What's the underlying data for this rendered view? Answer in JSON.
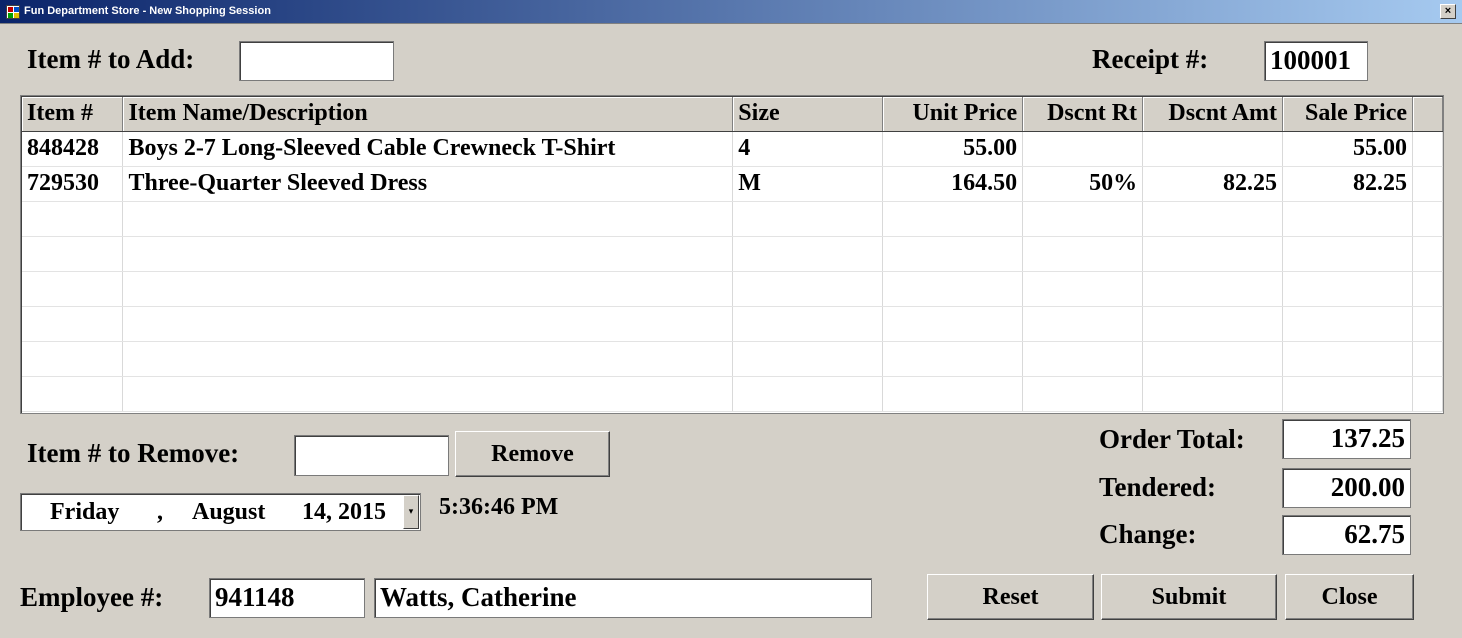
{
  "window": {
    "title": "Fun Department Store - New Shopping Session",
    "close_glyph": "×"
  },
  "add_item": {
    "label": "Item # to Add:",
    "value": ""
  },
  "receipt": {
    "label": "Receipt #:",
    "value": "100001"
  },
  "grid": {
    "columns": [
      "Item #",
      "Item Name/Description",
      "Size",
      "Unit Price",
      "Dscnt Rt",
      "Dscnt Amt",
      "Sale Price"
    ],
    "rows": [
      [
        "848428",
        "Boys 2-7 Long-Sleeved Cable Crewneck T-Shirt",
        "4",
        "55.00",
        "",
        "",
        "55.00"
      ],
      [
        "729530",
        "Three-Quarter Sleeved Dress",
        "M",
        "164.50",
        "50%",
        "82.25",
        "82.25"
      ]
    ]
  },
  "remove_item": {
    "label": "Item # to Remove:",
    "value": "",
    "button_label": "Remove"
  },
  "date": {
    "weekday": "Friday",
    "comma": ",",
    "month": "August",
    "day_year": "14, 2015",
    "dropdown_glyph": "▾"
  },
  "time": "5:36:46 PM",
  "totals": {
    "order_total_label": "Order Total:",
    "order_total": "137.25",
    "tendered_label": "Tendered:",
    "tendered": "200.00",
    "change_label": "Change:",
    "change": "62.75"
  },
  "employee": {
    "label": "Employee #:",
    "number": "941148",
    "name": "Watts, Catherine"
  },
  "actions": {
    "reset": "Reset",
    "submit": "Submit",
    "close": "Close"
  },
  "colors": {
    "window_bg": "#d4d0c8",
    "title_bar_start": "#0a246a",
    "title_bar_end": "#a6caf0"
  }
}
